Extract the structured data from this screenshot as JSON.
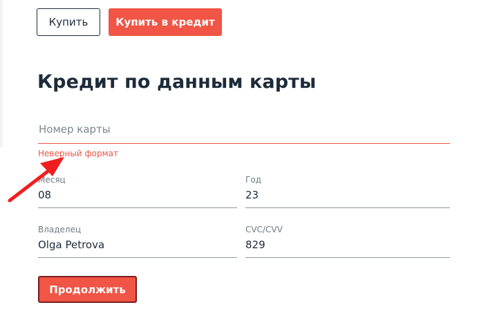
{
  "header": {
    "buy_label": "Купить",
    "credit_label": "Купить в кредит"
  },
  "form": {
    "title": "Кредит по данным карты",
    "card_number": {
      "placeholder": "Номер карты",
      "value": "",
      "error": "Неверный формат"
    },
    "month": {
      "label": "Месяц",
      "value": "08"
    },
    "year": {
      "label": "Год",
      "value": "23"
    },
    "owner": {
      "label": "Владелец",
      "value": "Olga Petrova"
    },
    "cvc": {
      "label": "CVC/CVV",
      "value": "829"
    },
    "continue_label": "Продолжить"
  },
  "annotation": {
    "icon": "red-arrow-icon",
    "color": "#f01e1e"
  },
  "colors": {
    "accent": "#f05545",
    "text": "#1d2b3a",
    "error": "#f05545"
  }
}
